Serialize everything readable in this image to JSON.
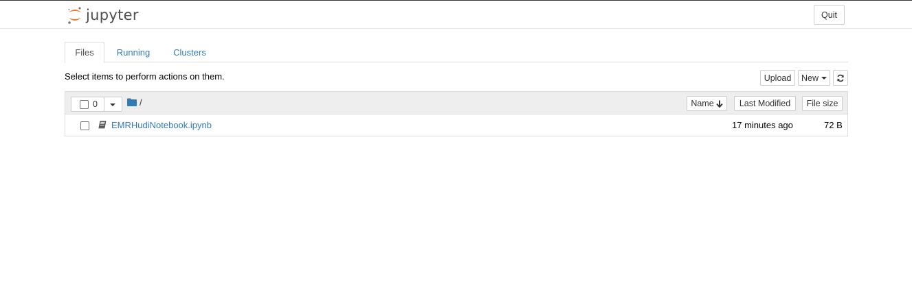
{
  "header": {
    "logo_text": "jupyter",
    "quit_label": "Quit"
  },
  "tabs": [
    {
      "label": "Files",
      "active": true
    },
    {
      "label": "Running",
      "active": false
    },
    {
      "label": "Clusters",
      "active": false
    }
  ],
  "toolbar": {
    "select_hint": "Select items to perform actions on them.",
    "upload_label": "Upload",
    "new_label": "New",
    "refresh_icon": "refresh-icon"
  },
  "list_header": {
    "selected_count": "0",
    "breadcrumb_separator": "/",
    "sort_name_label": "Name",
    "sort_modified_label": "Last Modified",
    "sort_size_label": "File size"
  },
  "files": [
    {
      "name": "EMRHudiNotebook.ipynb",
      "modified": "17 minutes ago",
      "size": "72 B",
      "icon": "notebook-icon"
    }
  ],
  "colors": {
    "link": "#337ab7",
    "logo_orange": "#f37726",
    "header_bg": "#eeeeee"
  }
}
